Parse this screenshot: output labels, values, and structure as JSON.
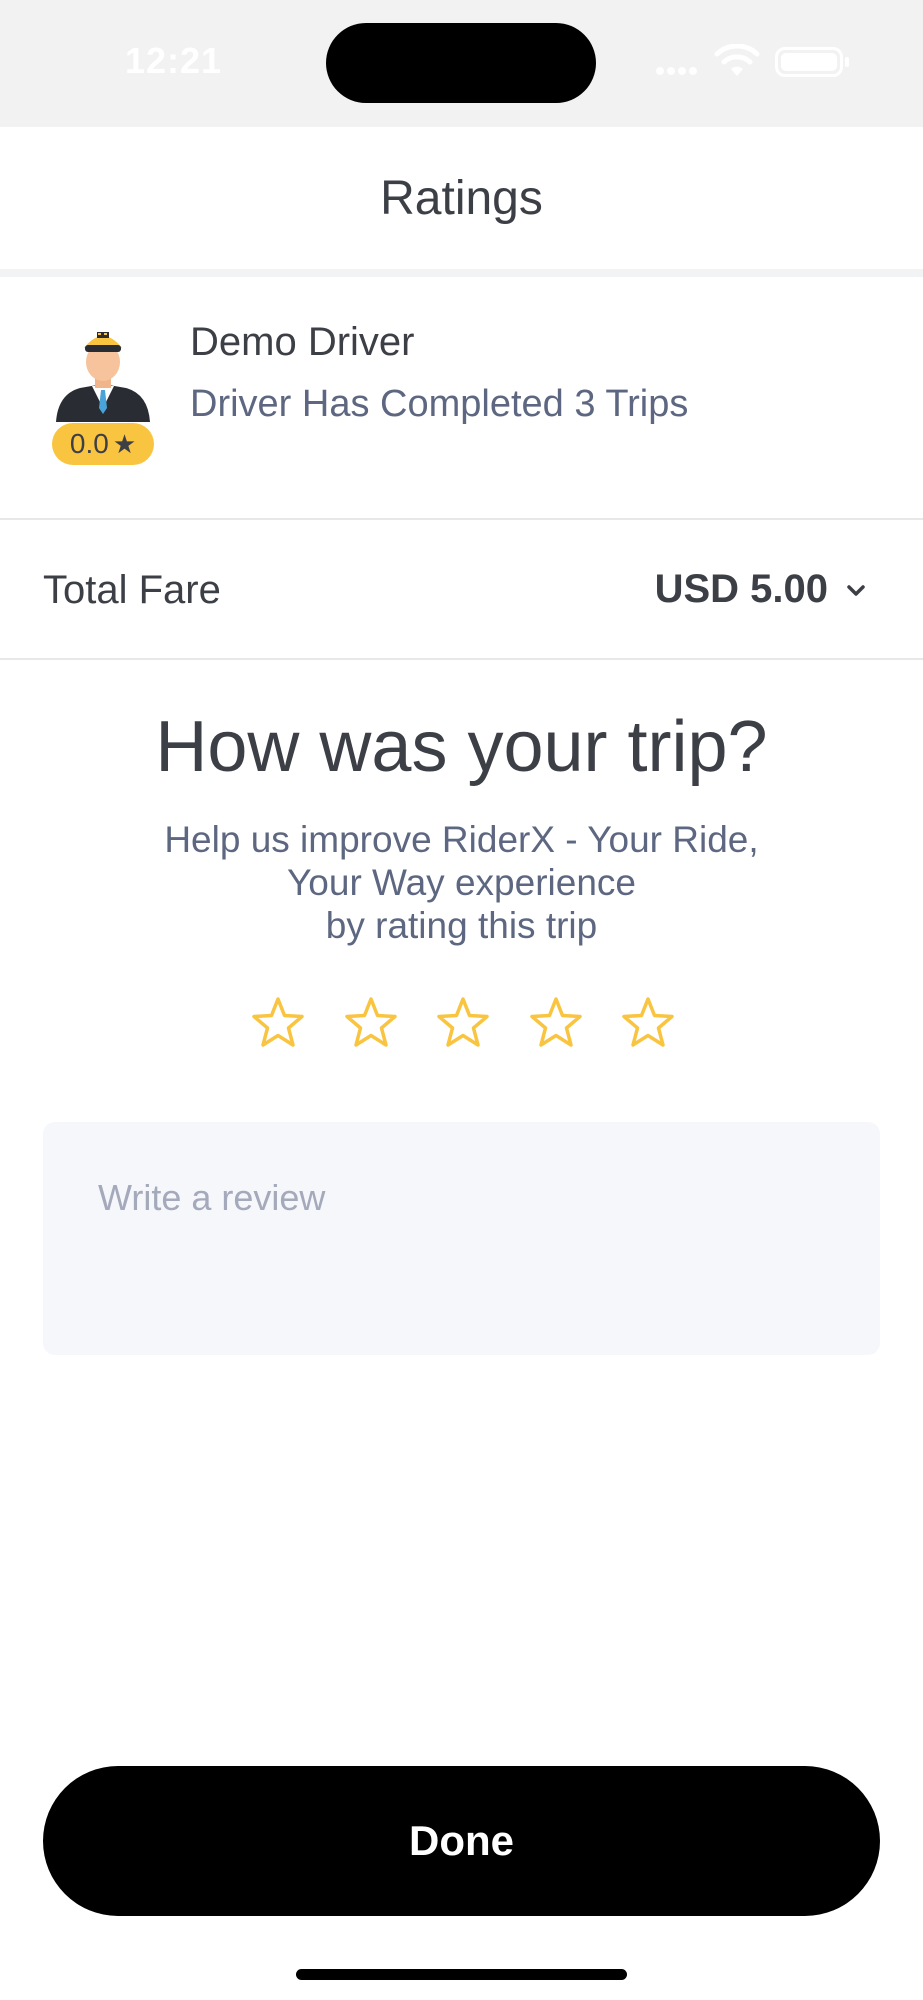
{
  "status_bar": {
    "time": "12:21"
  },
  "header": {
    "title": "Ratings"
  },
  "driver": {
    "name": "Demo Driver",
    "trips_text": "Driver Has Completed 3 Trips",
    "rating": "0.0",
    "rating_icon": "★"
  },
  "fare": {
    "label": "Total Fare",
    "value": "USD 5.00"
  },
  "feedback": {
    "question": "How was your trip?",
    "subtitle_line1": "Help us improve RiderX  - Your Ride,",
    "subtitle_line2": "Your Way experience",
    "subtitle_line3": "by rating this trip",
    "star_count": 5,
    "selected_stars": 0,
    "star_color": "#f9c440"
  },
  "review": {
    "placeholder": "Write a review"
  },
  "actions": {
    "done_label": "Done"
  }
}
